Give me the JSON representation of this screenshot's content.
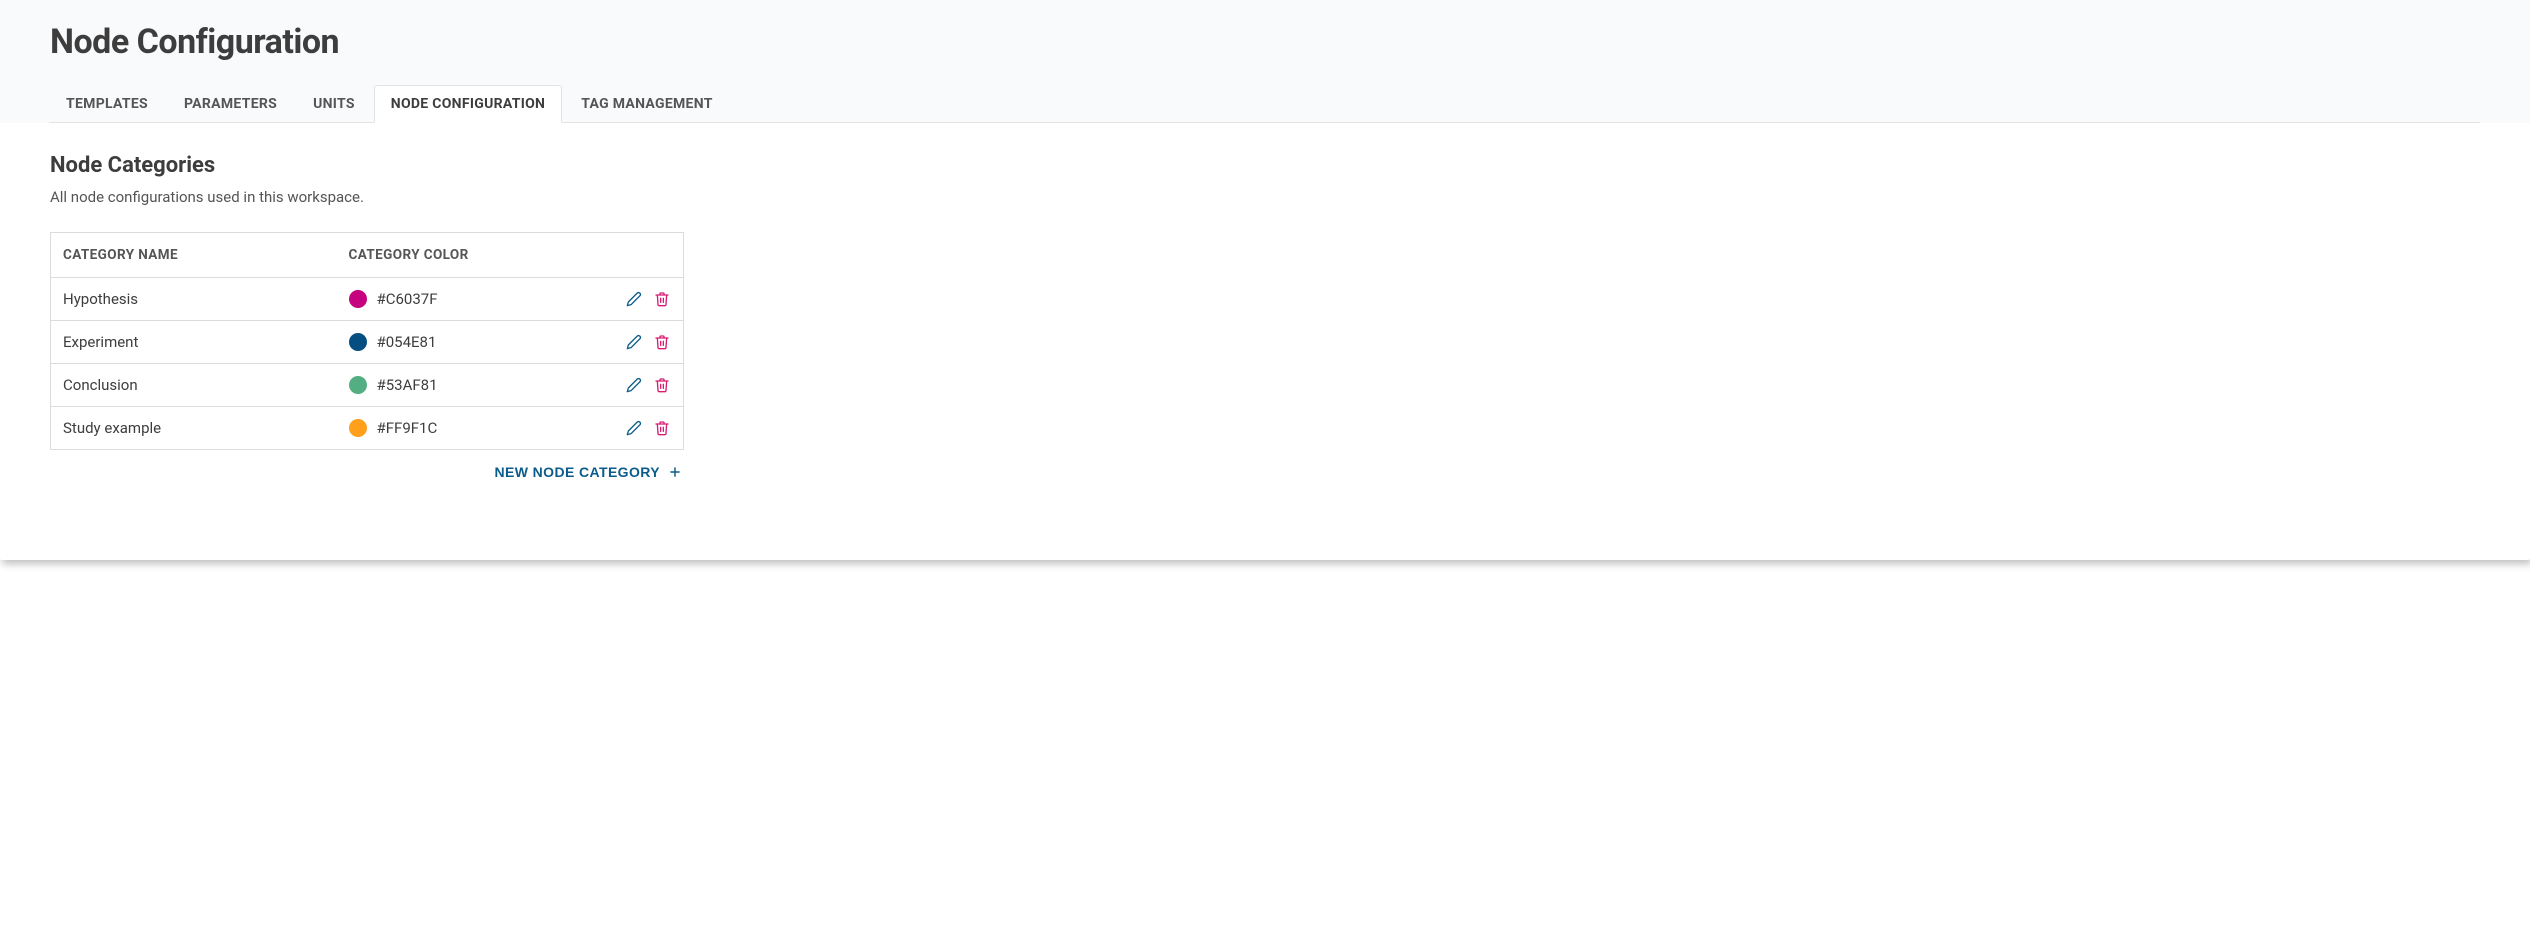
{
  "header": {
    "title": "Node Configuration"
  },
  "tabs": [
    {
      "label": "TEMPLATES",
      "active": false
    },
    {
      "label": "PARAMETERS",
      "active": false
    },
    {
      "label": "UNITS",
      "active": false
    },
    {
      "label": "NODE CONFIGURATION",
      "active": true
    },
    {
      "label": "TAG MANAGEMENT",
      "active": false
    }
  ],
  "section": {
    "title": "Node Categories",
    "subtitle": "All node configurations used in this workspace."
  },
  "table": {
    "headers": {
      "name": "CATEGORY NAME",
      "color": "CATEGORY COLOR"
    },
    "rows": [
      {
        "name": "Hypothesis",
        "color_hex": "#C6037F"
      },
      {
        "name": "Experiment",
        "color_hex": "#054E81"
      },
      {
        "name": "Conclusion",
        "color_hex": "#53AF81"
      },
      {
        "name": "Study example",
        "color_hex": "#FF9F1C"
      }
    ]
  },
  "actions": {
    "add_label": "NEW NODE CATEGORY"
  },
  "icons": {
    "edit_stroke": "#0b5c8a",
    "delete_stroke": "#d81b73",
    "plus_stroke": "#0b5c8a"
  }
}
